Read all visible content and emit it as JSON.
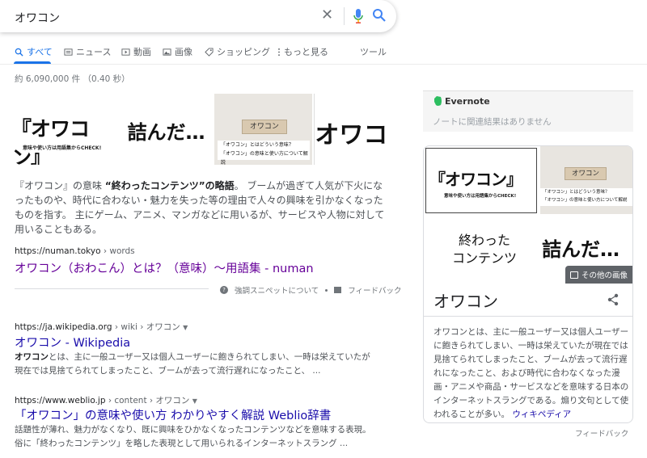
{
  "search": {
    "query": "オワコン"
  },
  "tabs": [
    {
      "label": "すべて",
      "icon": "search-icon"
    },
    {
      "label": "ニュース",
      "icon": "news-icon"
    },
    {
      "label": "動画",
      "icon": "video-icon"
    },
    {
      "label": "画像",
      "icon": "image-icon"
    },
    {
      "label": "ショッピング",
      "icon": "tag-icon"
    },
    {
      "label": "もっと見る",
      "icon": "more-vert-icon"
    },
    {
      "label": "ツール"
    }
  ],
  "stats": "約 6,090,000 件 （0.40 秒）",
  "strip": {
    "t1_big": "『オワコン』",
    "t1_small": "意味や使い方は用語集からCHECK!",
    "t2_big": "詰んだ…",
    "t3_block": "オワコン",
    "t3_cap1": "「オワコン」とはどういう意味？",
    "t3_cap2": "「オワコン」の意味と使い方について解説",
    "t4_big": "オワコ"
  },
  "featured": {
    "snippet_pre": "『オワコン』の意味 ",
    "snippet_bold": "“終わったコンテンツ”の略語",
    "snippet_post": "。 ブームが過ぎて人気が下火になったものや、時代に合わない・魅力を失った等の理由で人々の興味を引かなくなったものを指す。 主にゲーム、アニメ、マンガなどに用いるが、サービスや人物に対して用いることもある。",
    "cite_host": "https://numan.tokyo",
    "cite_path": " › words",
    "title": "オワコン（おわこん）とは？（意味）～用語集 - numan",
    "about": "強調スニペットについて",
    "feedback": "フィードバック"
  },
  "results": [
    {
      "cite_host": "https://ja.wikipedia.org",
      "cite_path": " › wiki › オワコン",
      "title": "オワコン - Wikipedia",
      "desc_bold": "オワコン",
      "desc1": "とは、主に一般ユーザー又は個人ユーザーに飽きられてしまい、一時は栄えていたが",
      "desc2": "現在では見捨てられてしまったこと、ブームが去って流行遅れになったこと、 ..."
    },
    {
      "cite_host": "https://www.weblio.jp",
      "cite_path": " › content › オワコン",
      "title": "「オワコン」の意味や使い方 わかりやすく解説 Weblio辞書",
      "desc1": "話題性が薄れ、魅力がなくなり、既に興味をひかなくなったコンテンツなどを意味する表現。",
      "desc2": "俗に「終わったコンテンツ」を略した表現として用いられるインターネットスラング ..."
    }
  ],
  "evernote": {
    "logo": "Evernote",
    "empty": "ノートに関連結果はありません"
  },
  "knowledge": {
    "k1_big": "『オワコン』",
    "k1_small": "意味や使い方は用語集からCHECK!",
    "k2_block": "オワコン",
    "k2_cap1": "「オワコン」とはどういう意味？",
    "k2_cap2": "「オワコン」の意味と使い方について解説",
    "k3_line1": "終わった",
    "k3_line2": "コンテンツ",
    "k4_big": "詰んだ…",
    "more_images": "その他の画像",
    "title": "オワコン",
    "desc": "オワコンとは、主に一般ユーザー又は個人ユーザーに飽きられてしまい、一時は栄えていたが現在では見捨てられてしまったこと、ブームが去って流行遅れになったこと、および時代に合わなくなった漫画・アニメや商品・サービスなどを意味する日本のインターネットスラングである。煽り文句として使われることが多い。",
    "source": "ウィキペディア",
    "feedback": "フィードバック"
  },
  "colors": {
    "accent": "#1a73e8",
    "link": "#1a0dab",
    "visited": "#660099"
  }
}
